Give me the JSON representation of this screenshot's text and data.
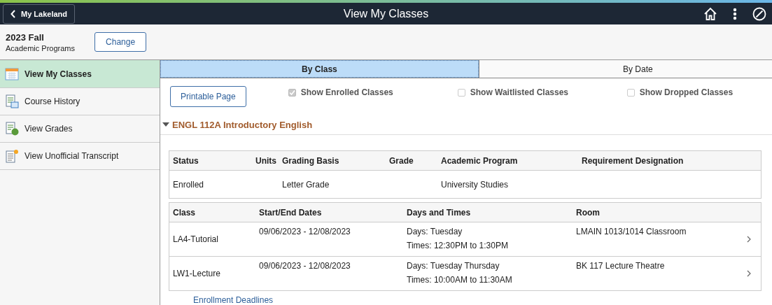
{
  "header": {
    "back_button": "My Lakeland",
    "title": "View My Classes"
  },
  "term": {
    "name": "2023 Fall",
    "career": "Academic Programs",
    "change_button": "Change"
  },
  "sidebar": {
    "items": [
      {
        "label": "View My Classes",
        "kind": "calendar",
        "selected": true
      },
      {
        "label": "Course History",
        "kind": "history",
        "selected": false
      },
      {
        "label": "View Grades",
        "kind": "grades",
        "selected": false
      },
      {
        "label": "View Unofficial Transcript",
        "kind": "transcript",
        "selected": false
      }
    ]
  },
  "tabs": [
    {
      "label": "By Class",
      "selected": true
    },
    {
      "label": "By Date",
      "selected": false
    }
  ],
  "printable_button": "Printable Page",
  "filters": [
    {
      "label": "Show Enrolled Classes",
      "checked": true
    },
    {
      "label": "Show Waitlisted Classes",
      "checked": false
    },
    {
      "label": "Show Dropped Classes",
      "checked": false
    }
  ],
  "course": {
    "title": "ENGL 112A Introductory English",
    "expanded": true,
    "details": {
      "columns": [
        "Status",
        "Units",
        "Grading Basis",
        "Grade",
        "Academic Program",
        "Requirement Designation"
      ],
      "row": {
        "status": "Enrolled",
        "grading_basis": "Letter Grade",
        "academic_program": "University Studies"
      }
    },
    "sections": {
      "columns": [
        "Class",
        "Start/End Dates",
        "Days and Times",
        "Room"
      ],
      "rows": [
        {
          "class": "LA4-Tutorial",
          "dates": "09/06/2023 - 12/08/2023",
          "days": "Days: Tuesday",
          "times": "Times: 12:30PM to 1:30PM",
          "room": "LMAIN 1013/1014 Classroom"
        },
        {
          "class": "LW1-Lecture",
          "dates": "09/06/2023 - 12/08/2023",
          "days": "Days: Tuesday Thursday",
          "times": "Times: 10:00AM to 11:30AM",
          "room": "BK 117 Lecture Theatre"
        }
      ]
    }
  },
  "link": "Enrollment Deadlines"
}
